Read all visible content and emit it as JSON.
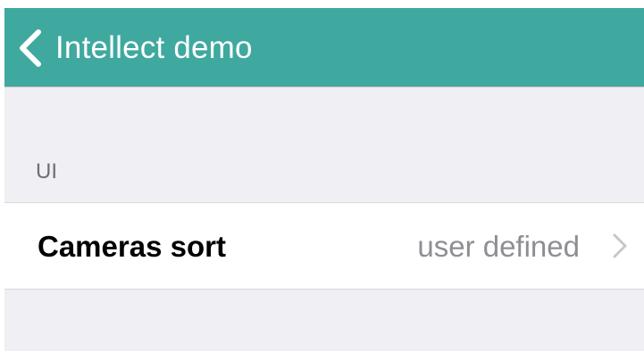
{
  "theme": {
    "accent": "#3fa9a0"
  },
  "navbar": {
    "back_icon": "chevron-left-icon",
    "title": "Intellect demo"
  },
  "section": {
    "header": "UI"
  },
  "rows": [
    {
      "label": "Cameras sort",
      "value": "user defined",
      "icon": "chevron-right-icon"
    }
  ]
}
